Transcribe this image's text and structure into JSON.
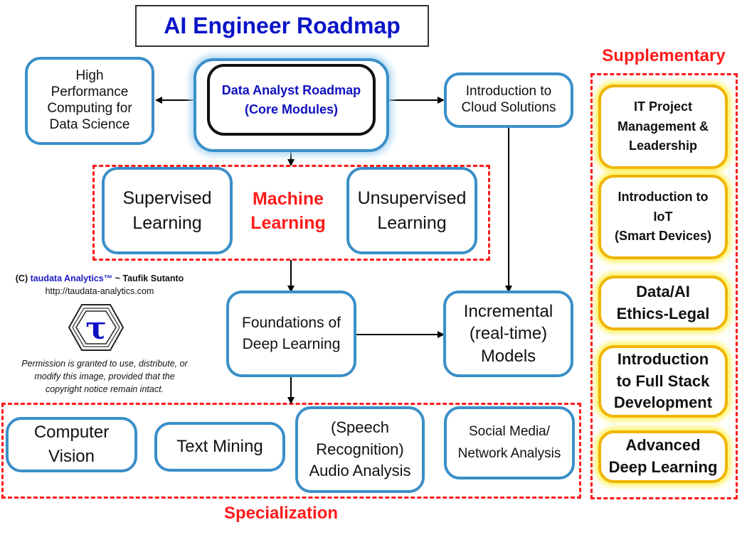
{
  "title": "AI Engineer Roadmap",
  "core": {
    "line1": "Data Analyst Roadmap",
    "line2": "(Core Modules)"
  },
  "hpc": {
    "lines": [
      "High",
      "Performance",
      "Computing for",
      "Data Science"
    ]
  },
  "cloud": {
    "lines": [
      "Introduction to",
      "Cloud Solutions"
    ]
  },
  "machine_learning": {
    "label_line1": "Machine",
    "label_line2": "Learning",
    "supervised": [
      "Supervised",
      "Learning"
    ],
    "unsupervised": [
      "Unsupervised",
      "Learning"
    ]
  },
  "deep_learning": {
    "lines": [
      "Foundations of",
      "Deep Learning"
    ]
  },
  "incremental": {
    "lines": [
      "Incremental",
      "(real-time)",
      "Models"
    ]
  },
  "specialization": {
    "label": "Specialization",
    "items": [
      {
        "lines": [
          "Computer",
          "Vision"
        ]
      },
      {
        "lines": [
          "Text Mining"
        ]
      },
      {
        "lines": [
          "(Speech",
          "Recognition)",
          "Audio Analysis"
        ]
      },
      {
        "lines": [
          "Social Media/",
          "Network Analysis"
        ]
      }
    ]
  },
  "supplementary": {
    "label": "Supplementary",
    "items": [
      {
        "lines": [
          "IT Project",
          "Management &",
          "Leadership"
        ]
      },
      {
        "lines": [
          "Introduction to",
          "IoT",
          "(Smart Devices)"
        ]
      },
      {
        "lines": [
          "Data/AI",
          "Ethics-Legal"
        ]
      },
      {
        "lines": [
          "Introduction",
          "to Full Stack",
          "Development"
        ]
      },
      {
        "lines": [
          "Advanced",
          "Deep Learning"
        ]
      }
    ]
  },
  "credits": {
    "prefix": "(C) ",
    "brand": "taudata Analytics™",
    "author": " ~ Taufik Sutanto",
    "url": "http://taudata-analytics.com",
    "logo_glyph": "τ",
    "permission": [
      "Permission is granted to use, distribute, or",
      "modify this image, provided that the",
      "copyright notice remain intact."
    ]
  }
}
